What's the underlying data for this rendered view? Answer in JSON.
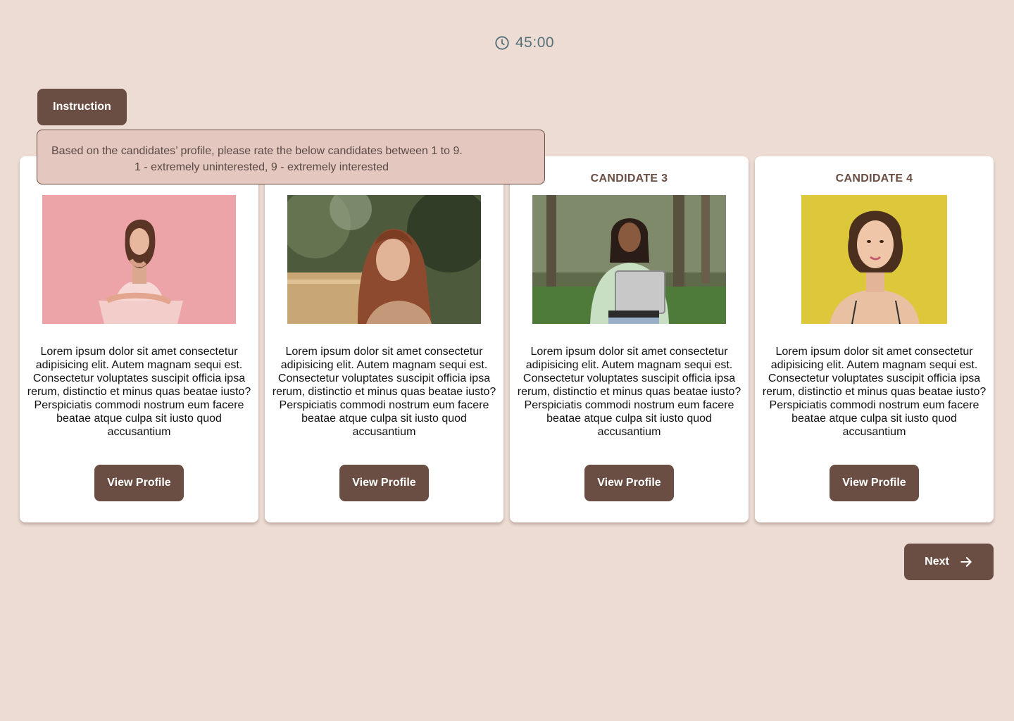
{
  "timer": {
    "icon": "clock-icon",
    "text": "45:00",
    "color": "#56707a"
  },
  "instruction": {
    "button_label": "Instruction",
    "line1": "Based on the candidates’ profile, please rate the below candidates between 1 to 9.",
    "line2": "1 - extremely uninterested, 9 - extremely interested"
  },
  "candidates": [
    {
      "title": "",
      "photo": "candidate-1-photo",
      "description": "Lorem ipsum dolor sit amet consectetur adipisicing elit. Autem magnam sequi est. Consectetur voluptates suscipit officia ipsa rerum, distinctio et minus quas beatae iusto? Perspiciatis commodi nostrum eum facere beatae atque culpa sit iusto quod accusantium",
      "button_label": "View Profile"
    },
    {
      "title": "",
      "photo": "candidate-2-photo",
      "description": "Lorem ipsum dolor sit amet consectetur adipisicing elit. Autem magnam sequi est. Consectetur voluptates suscipit officia ipsa rerum, distinctio et minus quas beatae iusto? Perspiciatis commodi nostrum eum facere beatae atque culpa sit iusto quod accusantium",
      "button_label": "View Profile"
    },
    {
      "title": "CANDIDATE 3",
      "photo": "candidate-3-photo",
      "description": "Lorem ipsum dolor sit amet consectetur adipisicing elit. Autem magnam sequi est. Consectetur voluptates suscipit officia ipsa rerum, distinctio et minus quas beatae iusto? Perspiciatis commodi nostrum eum facere beatae atque culpa sit iusto quod accusantium",
      "button_label": "View Profile"
    },
    {
      "title": "CANDIDATE 4",
      "photo": "candidate-4-photo",
      "description": "Lorem ipsum dolor sit amet consectetur adipisicing elit. Autem magnam sequi est. Consectetur voluptates suscipit officia ipsa rerum, distinctio et minus quas beatae iusto? Perspiciatis commodi nostrum eum facere beatae atque culpa sit iusto quod accusantium",
      "button_label": "View Profile"
    }
  ],
  "next": {
    "label": "Next",
    "icon": "arrow-right-icon"
  },
  "colors": {
    "background": "#ecdcd4",
    "accent": "#6a4e44",
    "instruction_panel": "#e4c8bf",
    "card": "#ffffff"
  }
}
